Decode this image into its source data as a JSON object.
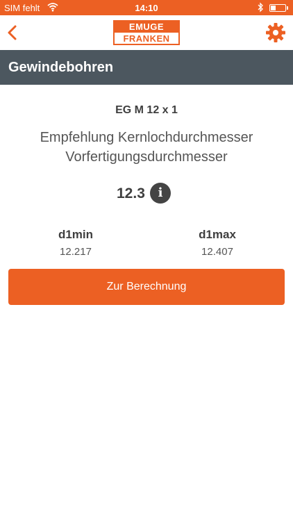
{
  "status_bar": {
    "carrier": "SIM fehlt",
    "time": "14:10",
    "wifi_icon": "wifi-icon",
    "bluetooth_icon": "bluetooth-icon",
    "battery_icon": "battery-icon"
  },
  "nav": {
    "back_icon": "chevron-left-icon",
    "logo_top": "EMUGE",
    "logo_bottom": "FRANKEN",
    "settings_icon": "gear-icon"
  },
  "header": {
    "title": "Gewindebohren"
  },
  "main": {
    "thread": "EG M 12 x 1",
    "recommend_line1": "Empfehlung Kernlochdurchmesser",
    "recommend_line2": "Vorfertigungsdurchmesser",
    "value": "12.3",
    "info_glyph": "i",
    "d1min_label": "d1min",
    "d1min_value": "12.217",
    "d1max_label": "d1max",
    "d1max_value": "12.407",
    "calc_button": "Zur Berechnung"
  },
  "colors": {
    "accent": "#ec6023",
    "header_bg": "#4c575f"
  }
}
